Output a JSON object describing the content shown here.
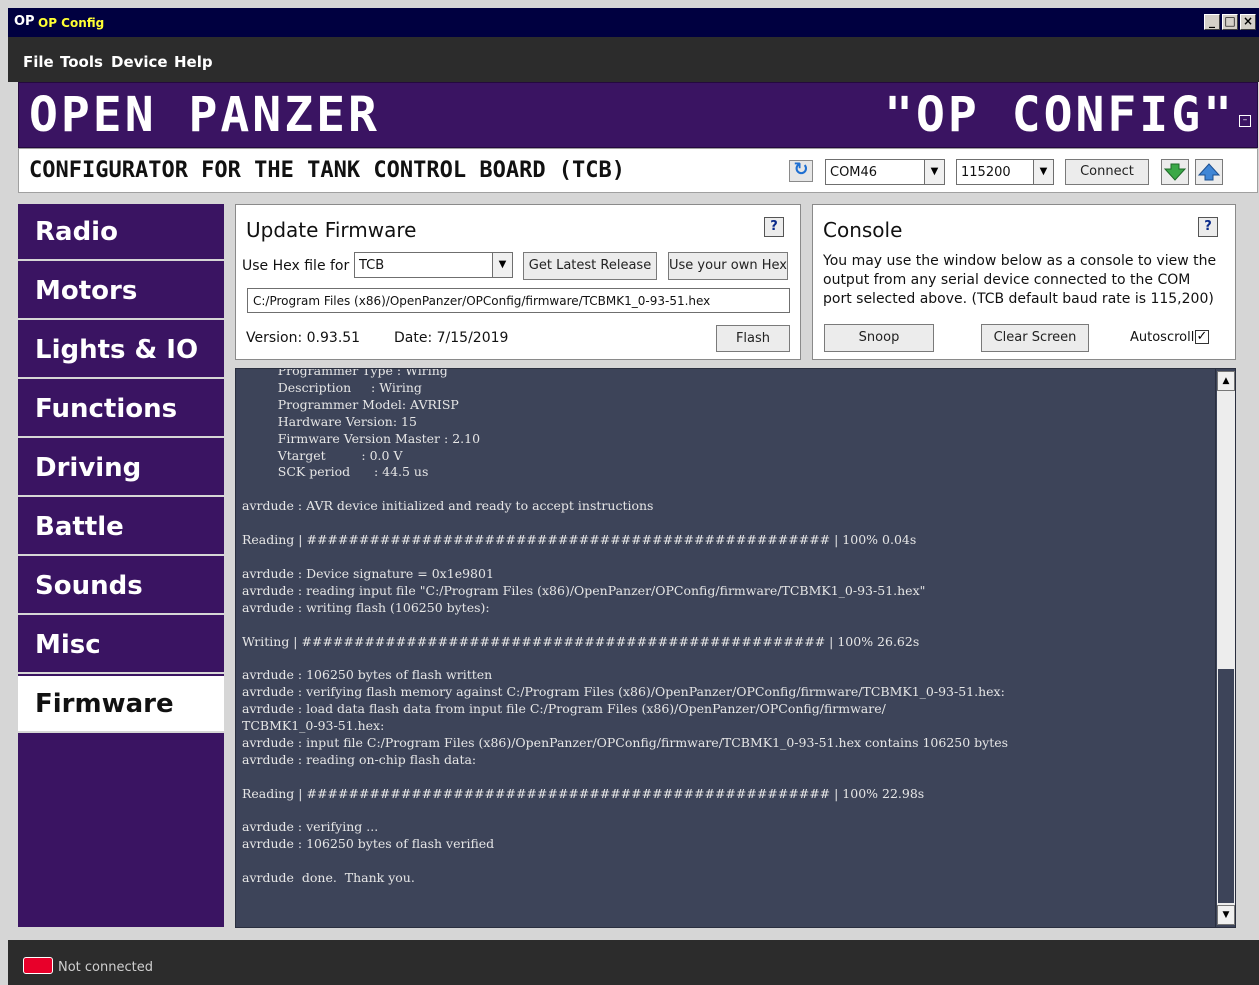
{
  "window": {
    "icon_text": "OP",
    "title": "OP Config",
    "controls": [
      "_",
      "□",
      "×"
    ]
  },
  "menu": [
    "File",
    "Tools",
    "Device",
    "Help"
  ],
  "banner": {
    "left": "OPEN PANZER",
    "right": "\"OP CONFIG\"",
    "mini_icon": "–"
  },
  "subbar": {
    "subtitle": "CONFIGURATOR FOR THE TANK CONTROL BOARD (TCB)",
    "port": "COM46",
    "baud": "115200",
    "connect_label": "Connect"
  },
  "sidebar": {
    "items": [
      {
        "label": "Radio"
      },
      {
        "label": "Motors"
      },
      {
        "label": "Lights & IO"
      },
      {
        "label": "Functions"
      },
      {
        "label": "Driving"
      },
      {
        "label": "Battle"
      },
      {
        "label": "Sounds"
      },
      {
        "label": "Misc"
      },
      {
        "label": "Firmware",
        "active": true
      }
    ]
  },
  "firmware_panel": {
    "title": "Update Firmware",
    "help": "?",
    "hex_label": "Use Hex file for",
    "hex_target": "TCB",
    "get_latest_label": "Get Latest Release",
    "use_own_label": "Use your own Hex",
    "path": "C:/Program Files (x86)/OpenPanzer/OPConfig/firmware/TCBMK1_0-93-51.hex",
    "version": "Version: 0.93.51",
    "date": "Date: 7/15/2019",
    "flash_label": "Flash"
  },
  "console_panel": {
    "title": "Console",
    "help": "?",
    "description": "You may use the window below as a console to view the output from any serial device connected to the COM port selected above. (TCB default baud rate is 115,200)",
    "snoop_label": "Snoop",
    "clear_label": "Clear Screen",
    "autoscroll_label": "Autoscroll",
    "autoscroll_checked": "✓"
  },
  "console_output": "         Programmer Type : Wiring\n         Description     : Wiring\n         Programmer Model: AVRISP\n         Hardware Version: 15\n         Firmware Version Master : 2.10\n         Vtarget         : 0.0 V\n         SCK period      : 44.5 us\n\navrdude : AVR device initialized and ready to accept instructions\n\nReading | ################################################## | 100% 0.04s\n\navrdude : Device signature = 0x1e9801\navrdude : reading input file \"C:/Program Files (x86)/OpenPanzer/OPConfig/firmware/TCBMK1_0-93-51.hex\"\navrdude : writing flash (106250 bytes):\n\nWriting | ################################################## | 100% 26.62s\n\navrdude : 106250 bytes of flash written\navrdude : verifying flash memory against C:/Program Files (x86)/OpenPanzer/OPConfig/firmware/TCBMK1_0-93-51.hex:\navrdude : load data flash data from input file C:/Program Files (x86)/OpenPanzer/OPConfig/firmware/\nTCBMK1_0-93-51.hex:\navrdude : input file C:/Program Files (x86)/OpenPanzer/OPConfig/firmware/TCBMK1_0-93-51.hex contains 106250 bytes\navrdude : reading on-chip flash data:\n\nReading | ################################################## | 100% 22.98s\n\navrdude : verifying ...\navrdude : 106250 bytes of flash verified\n\navrdude  done.  Thank you.",
  "status": {
    "text": "Not connected",
    "color": "#e8002a"
  },
  "colors": {
    "brand_purple": "#3a1462",
    "console_bg": "#3d4459"
  }
}
